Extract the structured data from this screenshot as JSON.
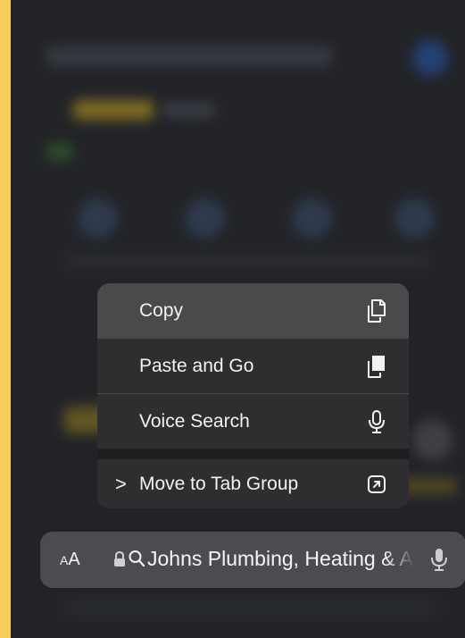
{
  "menu": {
    "items": [
      {
        "label": "Copy",
        "icon": "copy-icon"
      },
      {
        "label": "Paste and Go",
        "icon": "paste-icon"
      },
      {
        "label": "Voice Search",
        "icon": "microphone-icon"
      },
      {
        "label": "Move to Tab Group",
        "icon": "move-arrow-icon",
        "chevron": ">"
      }
    ]
  },
  "address_bar": {
    "text_size_label_small": "A",
    "text_size_label_large": "A",
    "url_text": "Johns Plumbing, Heating & Air Conditioning",
    "icons": [
      "lock-icon",
      "search-icon",
      "microphone-icon"
    ]
  },
  "colors": {
    "frame": "#f6cd5c",
    "menu_background": "#2e2e30",
    "highlighted_item": "#4a4a4d",
    "address_bar": "#4b4c50",
    "text": "#f2f2f2"
  }
}
